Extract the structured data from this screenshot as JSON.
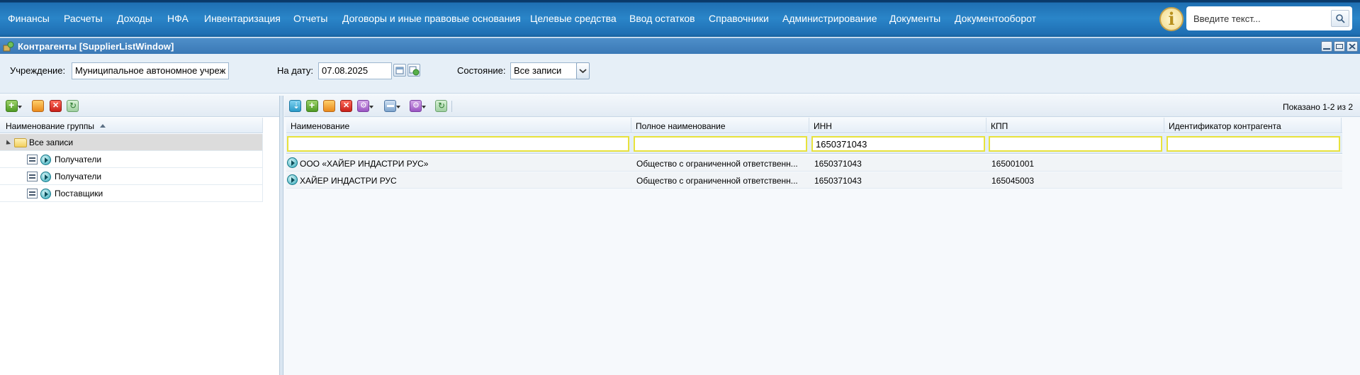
{
  "menu": {
    "items": [
      "Финансы",
      "Расчеты",
      "Доходы",
      "НФА",
      "Инвентаризация",
      "Отчеты",
      "Договоры и иные правовые основания",
      "Целевые средства",
      "Ввод остатков",
      "Справочники",
      "Администрирование",
      "Документы",
      "Документооборот"
    ],
    "search_placeholder": "Введите текст...",
    "info_glyph": "i"
  },
  "window": {
    "title": "Контрагенты [SupplierListWindow]"
  },
  "filters": {
    "institution_label": "Учреждение:",
    "institution_value": "Муниципальное автономное учреж",
    "date_label": "На дату:",
    "date_value": "07.08.2025",
    "state_label": "Состояние:",
    "state_value": "Все записи"
  },
  "tree": {
    "header": "Наименование группы",
    "items": [
      {
        "label": "Все записи"
      },
      {
        "label": "Получатели"
      },
      {
        "label": "Получатели"
      },
      {
        "label": "Поставщики"
      }
    ]
  },
  "grid": {
    "shown_text": "Показано 1-2 из 2",
    "columns": [
      "Наименование",
      "Полное наименование",
      "ИНН",
      "КПП",
      "Идентификатор контрагента"
    ],
    "filter_values": [
      "",
      "",
      "1650371043",
      "",
      ""
    ],
    "rows": [
      {
        "name": "ООО «ХАЙЕР ИНДАСТРИ РУС»",
        "full_name": "Общество с ограниченной ответственн...",
        "inn": "1650371043",
        "kpp": "165001001",
        "id": ""
      },
      {
        "name": "ХАЙЕР ИНДАСТРИ РУС",
        "full_name": "Общество с ограниченной ответственн...",
        "inn": "1650371043",
        "kpp": "165045003",
        "id": ""
      }
    ]
  }
}
